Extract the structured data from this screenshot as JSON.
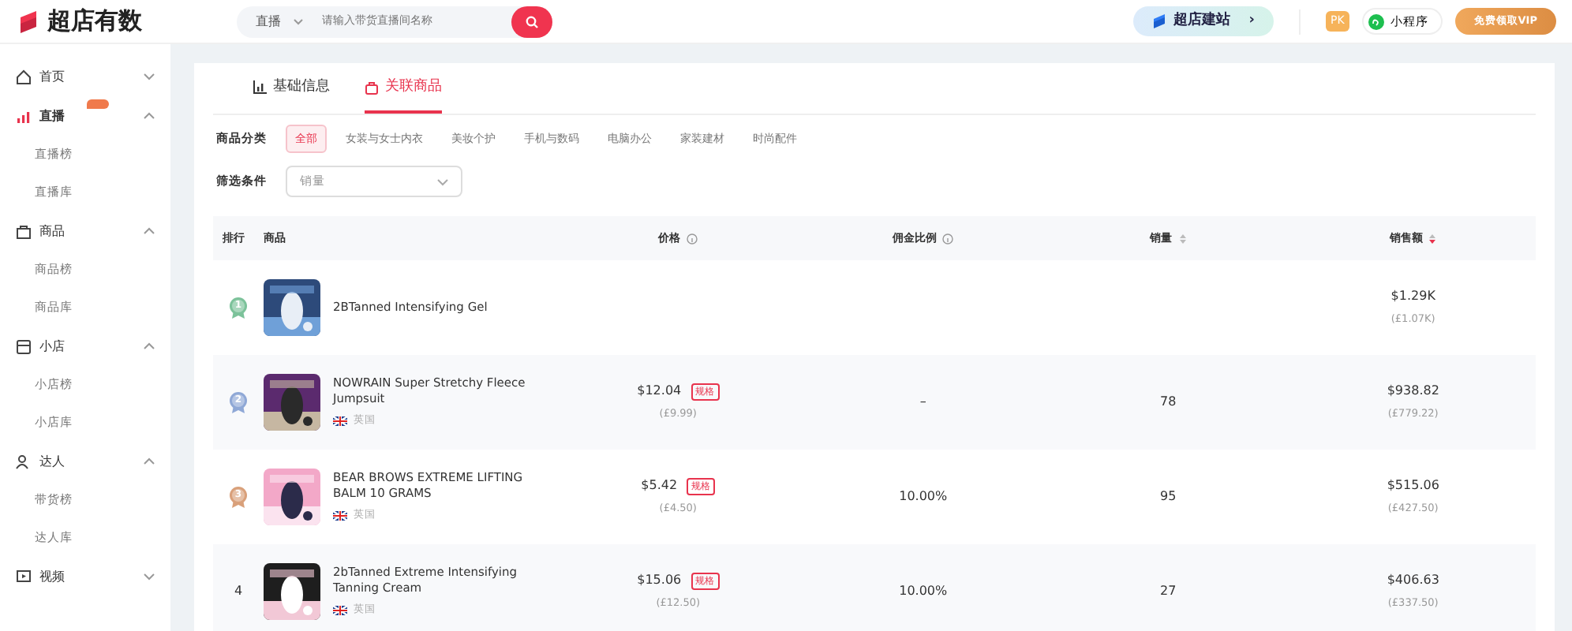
{
  "header": {
    "logo_text": "超店有数",
    "search": {
      "scope": "直播",
      "placeholder": "请输入带货直播间名称"
    },
    "site_button": {
      "label": "超店建站",
      "arrow": "›"
    },
    "pk_badge": "PK",
    "mini_program": "小程序",
    "vip_button": "免费领取VIP"
  },
  "sidebar": {
    "items": [
      {
        "label": "首页",
        "selected": false,
        "badge": false,
        "expanded": false
      },
      {
        "label": "直播",
        "selected": true,
        "badge": true,
        "expanded": true,
        "children": [
          {
            "label": "直播榜"
          },
          {
            "label": "直播库"
          }
        ]
      },
      {
        "label": "商品",
        "selected": false,
        "badge": false,
        "expanded": true,
        "children": [
          {
            "label": "商品榜"
          },
          {
            "label": "商品库"
          }
        ]
      },
      {
        "label": "小店",
        "selected": false,
        "badge": false,
        "expanded": true,
        "children": [
          {
            "label": "小店榜"
          },
          {
            "label": "小店库"
          }
        ]
      },
      {
        "label": "达人",
        "selected": false,
        "badge": false,
        "expanded": true,
        "children": [
          {
            "label": "带货榜"
          },
          {
            "label": "达人库"
          }
        ]
      },
      {
        "label": "视频",
        "selected": false,
        "badge": false,
        "expanded": false
      }
    ]
  },
  "tabs": [
    {
      "label": "基础信息",
      "selected": false
    },
    {
      "label": "关联商品",
      "selected": true
    }
  ],
  "category_filter": {
    "label": "商品分类",
    "options": [
      {
        "label": "全部",
        "selected": true
      },
      {
        "label": "女装与女士内衣",
        "selected": false
      },
      {
        "label": "美妆个护",
        "selected": false
      },
      {
        "label": "手机与数码",
        "selected": false
      },
      {
        "label": "电脑办公",
        "selected": false
      },
      {
        "label": "家装建材",
        "selected": false
      },
      {
        "label": "时尚配件",
        "selected": false
      }
    ]
  },
  "condition_filter": {
    "label": "筛选条件",
    "value": "销量"
  },
  "table": {
    "columns": [
      {
        "label": "排行",
        "info": false,
        "sortable": false
      },
      {
        "label": "商品",
        "info": false,
        "sortable": false
      },
      {
        "label": "价格",
        "info": true,
        "sortable": false
      },
      {
        "label": "佣金比例",
        "info": true,
        "sortable": false
      },
      {
        "label": "销量",
        "info": false,
        "sortable": true,
        "sort_desc": false
      },
      {
        "label": "销售额",
        "info": false,
        "sortable": true,
        "sort_desc": true
      }
    ],
    "rows": [
      {
        "kind": "medal",
        "rank": "1",
        "name": "2BTanned Intensifying Gel",
        "revenue": "$1.29K",
        "revenue_local": "(£1.07K)"
      },
      {
        "kind": "medal",
        "rank": "2",
        "name": "NOWRAIN Super Stretchy Fleece Jumpsuit",
        "country": "英国",
        "price": "$12.04",
        "price_tag": "规格",
        "price_local": "(£9.99)",
        "commission": "–",
        "sales": "78",
        "revenue": "$938.82",
        "revenue_local": "(£779.22)"
      },
      {
        "kind": "medal",
        "rank": "3",
        "name": "BEAR BROWS EXTREME LIFTING BALM 10 GRAMS",
        "country": "英国",
        "price": "$5.42",
        "price_tag": "规格",
        "price_local": "(£4.50)",
        "commission": "10.00%",
        "sales": "95",
        "revenue": "$515.06",
        "revenue_local": "(£427.50)"
      },
      {
        "kind": "plain",
        "rank": "4",
        "name": "2bTanned Extreme Intensifying Tanning Cream",
        "country": "英国",
        "price": "$15.06",
        "price_tag": "规格",
        "price_local": "(£12.50)",
        "commission": "10.00%",
        "sales": "27",
        "revenue": "$406.63",
        "revenue_local": "(£337.50)"
      }
    ]
  }
}
